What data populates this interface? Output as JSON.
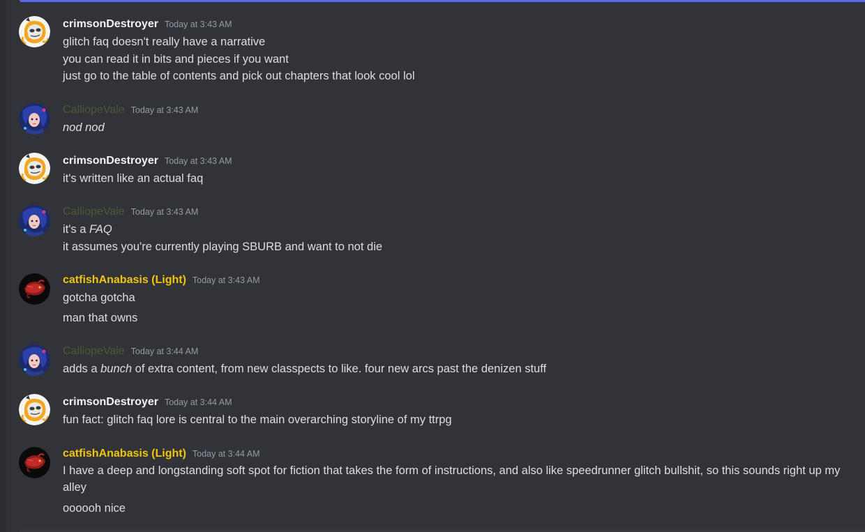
{
  "channel_messages": [
    {
      "author": "crimsonDestroyer",
      "author_color": "#f2f3f5",
      "avatar": "crimson-avatar",
      "timestamp": "Today at 3:43 AM",
      "lines": [
        "glitch faq doesn't really have a narrative",
        "you can read it in bits and pieces if you want",
        "just go to the table of contents and pick out chapters that look cool lol"
      ]
    },
    {
      "author": "CalliopeVale",
      "author_color": "#4c5a33",
      "avatar": "calliope-avatar",
      "timestamp": "Today at 3:43 AM",
      "lines": [
        {
          "italic": "nod nod"
        }
      ]
    },
    {
      "author": "crimsonDestroyer",
      "author_color": "#f2f3f5",
      "avatar": "crimson-avatar",
      "timestamp": "Today at 3:43 AM",
      "lines": [
        "it's written like an actual faq"
      ]
    },
    {
      "author": "CalliopeVale",
      "author_color": "#4c5a33",
      "avatar": "calliope-avatar",
      "timestamp": "Today at 3:43 AM",
      "lines": [
        {
          "before": "it's a ",
          "italic": "FAQ",
          "after": ""
        },
        "it assumes you're currently playing SBURB and want to not die"
      ]
    },
    {
      "author": "catfishAnabasis (Light)",
      "author_color": "#f1c40f",
      "avatar": "catfish-avatar",
      "timestamp": "Today at 3:43 AM",
      "lines": [
        "gotcha gotcha",
        "man that owns"
      ]
    },
    {
      "author": "CalliopeVale",
      "author_color": "#4c5a33",
      "avatar": "calliope-avatar",
      "timestamp": "Today at 3:44 AM",
      "lines": [
        {
          "before": "adds a ",
          "italic": "bunch",
          "after": " of extra content, from new classpects to like. four new arcs past the denizen stuff"
        }
      ]
    },
    {
      "author": "crimsonDestroyer",
      "author_color": "#f2f3f5",
      "avatar": "crimson-avatar",
      "timestamp": "Today at 3:44 AM",
      "lines": [
        "fun fact: glitch faq lore is central to the main overarching storyline of my ttrpg"
      ]
    },
    {
      "author": "catfishAnabasis (Light)",
      "author_color": "#f1c40f",
      "avatar": "catfish-avatar",
      "timestamp": "Today at 3:44 AM",
      "lines": [
        "I have a deep and longstanding soft spot for fiction that takes the form of instructions, and also like speedrunner glitch bullshit, so this sounds right up my alley",
        "oooooh nice"
      ]
    }
  ]
}
